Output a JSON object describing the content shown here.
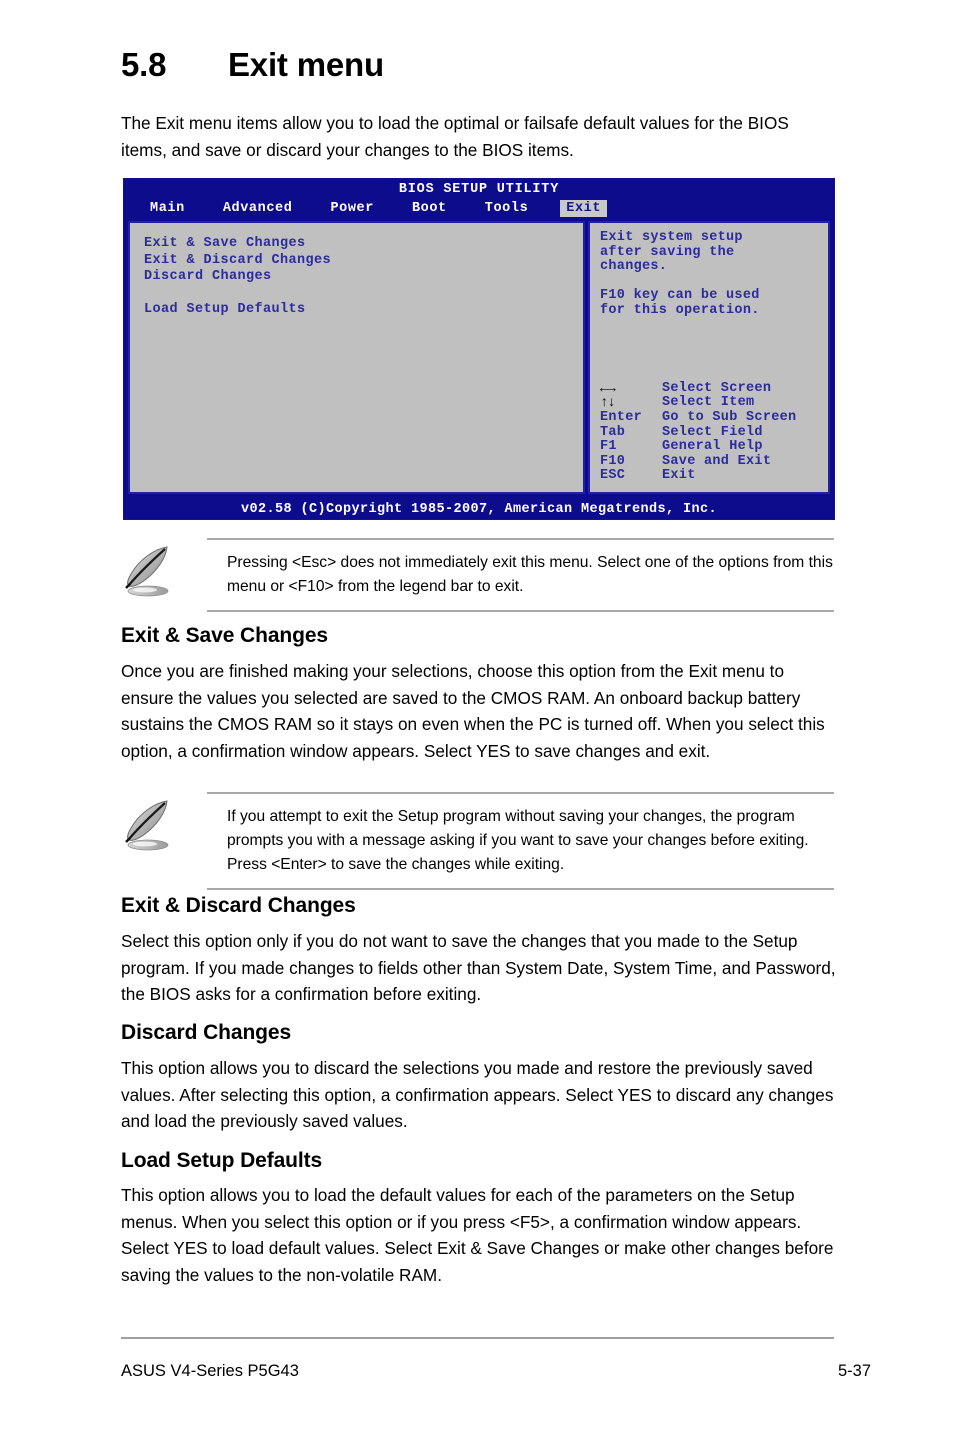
{
  "section": {
    "number": "5.8",
    "title": "Exit menu",
    "intro": "The Exit menu items allow you to load the optimal or failsafe default values for the BIOS items, and save or discard your changes to the BIOS items."
  },
  "bios": {
    "title": "BIOS SETUP UTILITY",
    "tabs": [
      {
        "label": "Main",
        "active": false
      },
      {
        "label": "Advanced",
        "active": false
      },
      {
        "label": "Power",
        "active": false
      },
      {
        "label": "Boot",
        "active": false
      },
      {
        "label": "Tools",
        "active": false
      },
      {
        "label": "Exit",
        "active": true
      }
    ],
    "menu_items": [
      "Exit & Save Changes",
      "Exit & Discard Changes",
      "Discard Changes"
    ],
    "menu_items_group2": [
      "Load Setup Defaults"
    ],
    "help_lines": [
      "Exit system setup",
      "after saving the",
      "changes."
    ],
    "help_lines2": [
      "F10 key can be used",
      "for this operation."
    ],
    "legend": [
      {
        "key": "←→",
        "desc": "Select Screen",
        "arrows": true
      },
      {
        "key": "↑↓",
        "desc": "Select Item",
        "arrows": true
      },
      {
        "key": "Enter",
        "desc": "Go to Sub Screen",
        "arrows": false
      },
      {
        "key": "Tab",
        "desc": "Select Field",
        "arrows": false
      },
      {
        "key": "F1",
        "desc": "General Help",
        "arrows": false
      },
      {
        "key": "F10",
        "desc": "Save and Exit",
        "arrows": false
      },
      {
        "key": "ESC",
        "desc": "Exit",
        "arrows": false
      }
    ],
    "footer": "v02.58 (C)Copyright 1985-2007, American Megatrends, Inc.",
    "colors": {
      "background": "#0c0c8c",
      "panel": "#c0c0c0",
      "panel_border": "#2222a0",
      "text": "#2b2b9c",
      "header_text": "#ffffff",
      "active_tab_bg": "#c8c8c8"
    }
  },
  "note1": {
    "icon": "pencil-note-icon",
    "text": "Pressing <Esc> does not immediately exit this menu. Select one of the options from this menu or <F10> from the legend bar to exit."
  },
  "note2": {
    "icon": "pencil-note-icon",
    "text": " If you attempt to exit the Setup program without saving your changes, the program prompts you with a message asking if you want to save your changes before exiting. Press <Enter>  to save the  changes while exiting."
  },
  "sections": [
    {
      "heading": "Exit & Save Changes",
      "body": "Once you are finished making your selections, choose this option from the Exit menu to ensure the values you selected are saved to the CMOS RAM. An onboard backup battery sustains the CMOS RAM so it stays on even when the PC is turned off. When you select this option, a confirmation window appears. Select YES to save changes and exit."
    },
    {
      "heading": "Exit & Discard Changes",
      "body": "Select this option only if you do not want to save the changes that you  made to the Setup program. If you made changes to fields other than System Date, System Time, and Password, the BIOS asks for a confirmation before exiting."
    },
    {
      "heading": "Discard Changes",
      "body": "This option allows you to discard the selections you made and restore the previously saved values. After selecting this option, a confirmation appears. Select YES to discard any changes and load the previously saved values."
    },
    {
      "heading": "Load Setup Defaults",
      "body": "This option allows you to load the default values for each of the parameters on the Setup menus. When you select this option or if you press <F5>, a confirmation window appears. Select YES to load default values. Select Exit & Save Changes or make other changes before saving the values to the non-volatile RAM."
    }
  ],
  "page_footer": {
    "left": "ASUS V4-Series P5G43",
    "right": "5-37"
  }
}
